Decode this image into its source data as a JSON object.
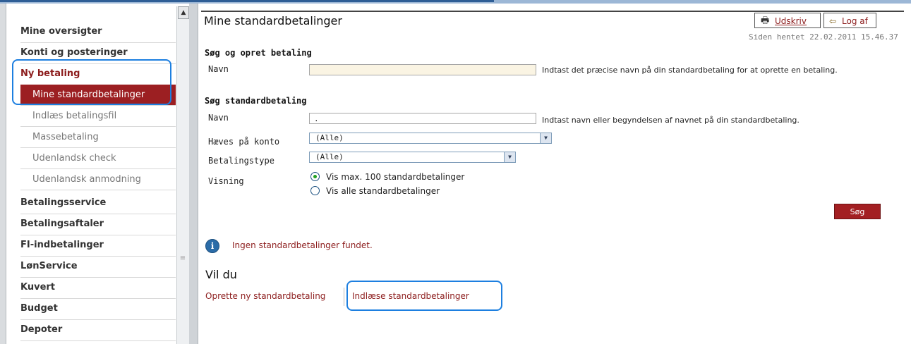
{
  "sidebar": {
    "items": [
      {
        "label": "Mine oversigter"
      },
      {
        "label": "Konti og posteringer"
      },
      {
        "label": "Ny betaling"
      },
      {
        "label": "Mine standardbetalinger"
      },
      {
        "label": "Indlæs betalingsfil"
      },
      {
        "label": "Massebetaling"
      },
      {
        "label": "Udenlandsk check"
      },
      {
        "label": "Udenlandsk anmodning"
      },
      {
        "label": "Betalingsservice"
      },
      {
        "label": "Betalingsaftaler"
      },
      {
        "label": "FI-indbetalinger"
      },
      {
        "label": "LønService"
      },
      {
        "label": "Kuvert"
      },
      {
        "label": "Budget"
      },
      {
        "label": "Depoter"
      }
    ]
  },
  "header": {
    "title": "Mine standardbetalinger",
    "print_label": "Udskriv",
    "logout_label": "Log af",
    "timestamp": "Siden hentet 22.02.2011 15.46.37"
  },
  "create_section": {
    "heading": "Søg og opret betaling",
    "name_label": "Navn",
    "name_value": "",
    "hint": "Indtast det præcise navn på din standardbetaling for at oprette en betaling."
  },
  "search_section": {
    "heading": "Søg standardbetaling",
    "name_label": "Navn",
    "name_value": ".",
    "name_hint": "Indtast navn eller begyndelsen af navnet på din standardbetaling.",
    "account_label": "Hæves på konto",
    "account_value": "(Alle)",
    "type_label": "Betalingstype",
    "type_value": "(Alle)",
    "view_label": "Visning",
    "view_option_1": "Vis max. 100 standardbetalinger",
    "view_option_2": "Vis alle standardbetalinger",
    "view_selected": 1,
    "search_button": "Søg"
  },
  "info": {
    "message": "Ingen standardbetalinger fundet."
  },
  "actions": {
    "heading": "Vil du",
    "link_create": "Oprette ny standardbetaling",
    "link_import": "Indlæse standardbetalinger"
  },
  "colors": {
    "brand_red": "#a31f22",
    "link_red": "#8c1c1c",
    "highlight_blue": "#1d7fe0"
  }
}
